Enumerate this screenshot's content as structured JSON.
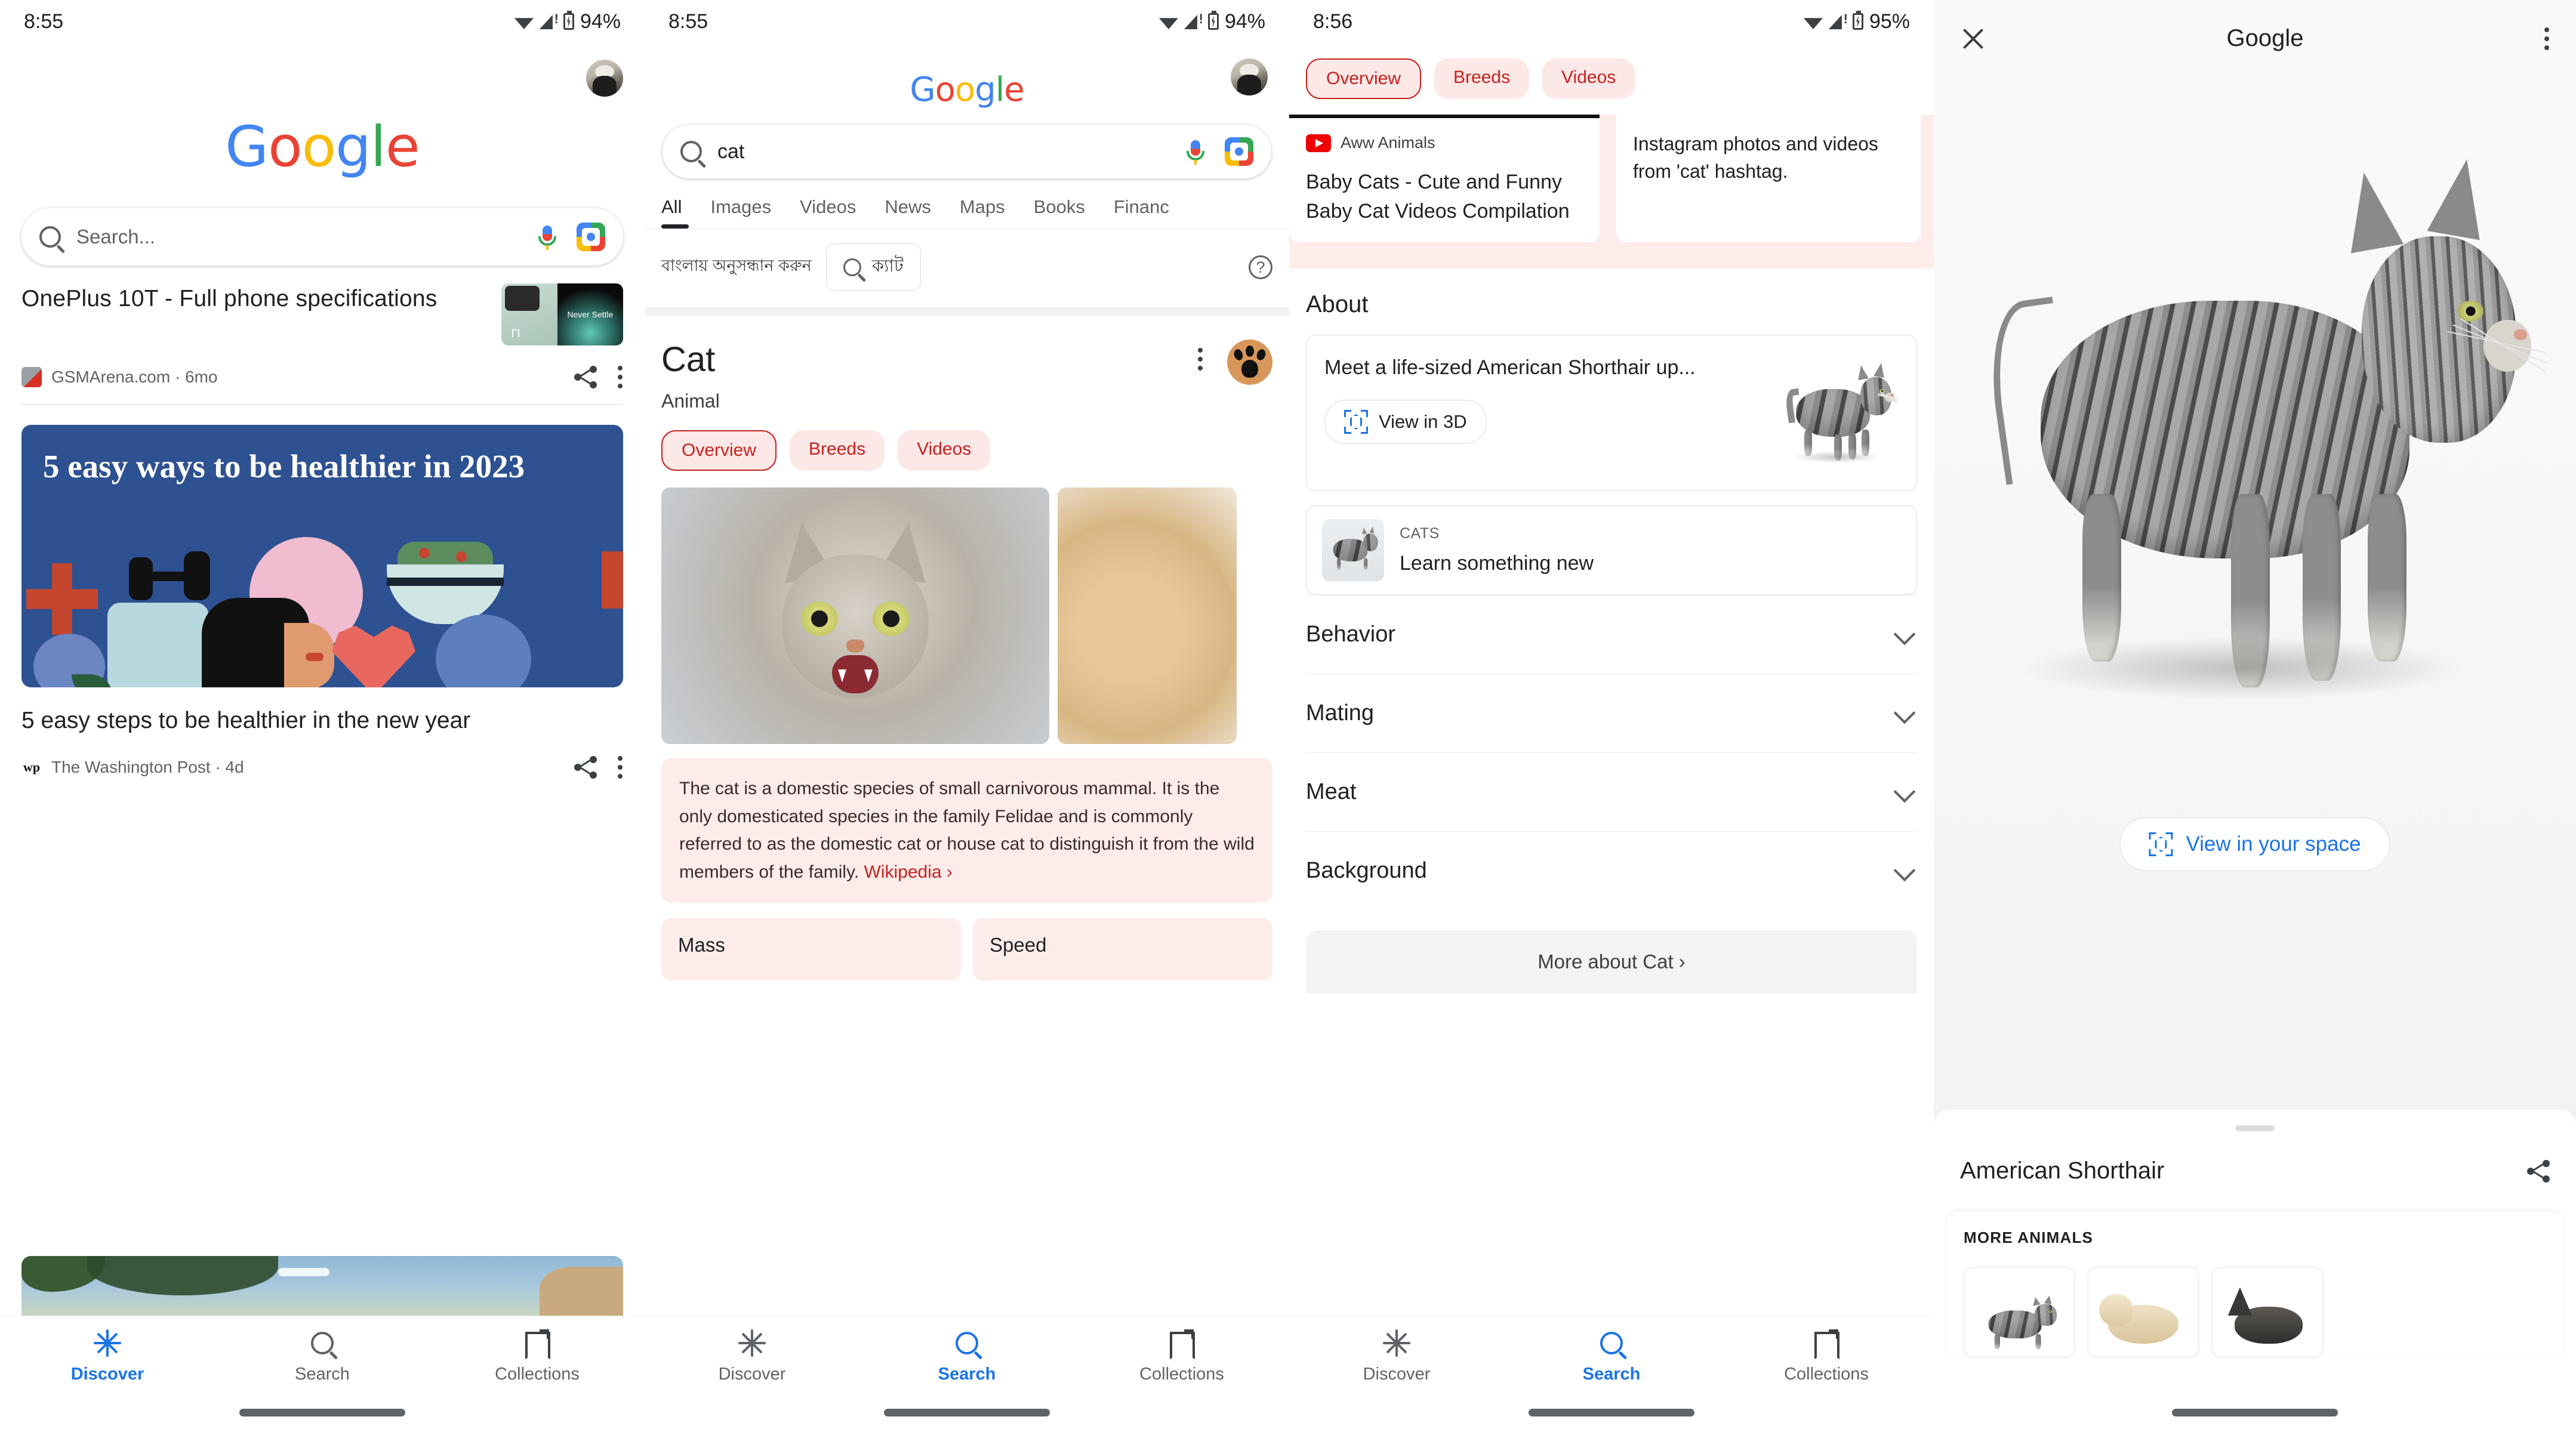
{
  "panels": {
    "discover": {
      "status": {
        "time": "8:55",
        "battery": "94%"
      },
      "logo": "Google",
      "search_placeholder": "Search...",
      "cards": [
        {
          "title": "OnePlus 10T - Full phone specifications",
          "source": "GSMArena.com · 6mo",
          "thumb_text": "Never Settle"
        },
        {
          "banner_headline": "5 easy ways to be healthier in 2023",
          "title": "5 easy steps to be healthier in the new year",
          "source": "The Washington Post · 4d",
          "source_mark": "wp"
        }
      ],
      "nav": [
        {
          "label": "Discover",
          "icon": "sparkle-icon",
          "active": true
        },
        {
          "label": "Search",
          "icon": "search-icon",
          "active": false
        },
        {
          "label": "Collections",
          "icon": "bookmark-icon",
          "active": false
        }
      ]
    },
    "results": {
      "status": {
        "time": "8:55",
        "battery": "94%"
      },
      "logo": "Google",
      "query": "cat",
      "tabs": [
        "All",
        "Images",
        "Videos",
        "News",
        "Maps",
        "Books",
        "Financ"
      ],
      "active_tab": "All",
      "translate": {
        "label": "বাংলায় অনুসন্ধান করুন",
        "chip_text": "ক্যাট"
      },
      "knowledge": {
        "title": "Cat",
        "subtitle": "Animal",
        "chips": [
          "Overview",
          "Breeds",
          "Videos"
        ],
        "active_chip": "Overview",
        "description": "The cat is a domestic species of small carnivorous mammal. It is the only domesticated species in the family Felidae and is commonly referred to as the domestic cat or house cat to distinguish it from the wild members of the family. ",
        "description_link": "Wikipedia ›",
        "facts": [
          "Mass",
          "Speed"
        ]
      },
      "nav": [
        {
          "label": "Discover",
          "icon": "sparkle-icon",
          "active": false
        },
        {
          "label": "Search",
          "icon": "search-icon",
          "active": true
        },
        {
          "label": "Collections",
          "icon": "bookmark-icon",
          "active": false
        }
      ]
    },
    "knowledge": {
      "status": {
        "time": "8:56",
        "battery": "95%"
      },
      "chips": [
        "Overview",
        "Breeds",
        "Videos"
      ],
      "active_chip": "Overview",
      "cards": [
        {
          "channel": "Aww Animals",
          "title": "Baby Cats - Cute and Funny Baby Cat Videos Compilation"
        },
        {
          "body": "Instagram photos and videos from 'cat' hashtag."
        }
      ],
      "about_heading": "About",
      "about_card": {
        "text": "Meet a life-sized American Shorthair up...",
        "button": "View in 3D"
      },
      "learn_card": {
        "kicker": "CATS",
        "label": "Learn something new"
      },
      "accordion": [
        "Behavior",
        "Mating",
        "Meat",
        "Background"
      ],
      "more_about": "More about Cat  ›",
      "nav": [
        {
          "label": "Discover",
          "icon": "sparkle-icon",
          "active": false
        },
        {
          "label": "Search",
          "icon": "search-icon",
          "active": true
        },
        {
          "label": "Collections",
          "icon": "bookmark-icon",
          "active": false
        }
      ]
    },
    "viewer": {
      "title": "Google",
      "ar_button": "View in your space",
      "model_name": "American Shorthair",
      "more_heading": "MORE ANIMALS",
      "more_items": [
        "cat",
        "golden-retriever",
        "french-bulldog"
      ]
    }
  },
  "colors": {
    "google_blue": "#4285f4",
    "google_red": "#ea4335",
    "google_yellow": "#fbbc05",
    "google_green": "#34a853",
    "accent_red": "#c5221f",
    "chip_bg": "#fce8e6",
    "link_blue": "#1a73e8"
  }
}
